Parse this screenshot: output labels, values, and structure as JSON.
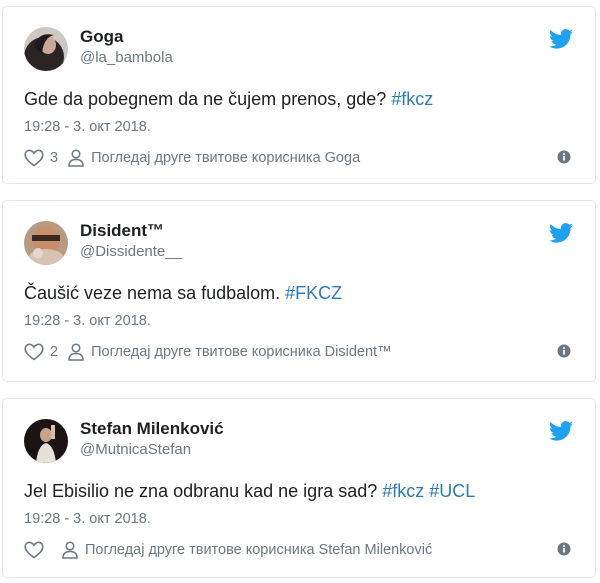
{
  "colors": {
    "hashtag": "#2b7bb9",
    "twitter_blue": "#1da1f2",
    "muted": "#697882",
    "text": "#1c2022",
    "border": "#e1e8ed"
  },
  "tweets": [
    {
      "name": "Goga",
      "handle": "@la_bambola",
      "text": "Gde da pobegnem da ne čujem prenos, gde? ",
      "hashtags": [
        "#fkcz"
      ],
      "date": "19:28 - 3. окт 2018.",
      "likes": "3",
      "profile_link": "Погледај друге твитове корисника Goga",
      "icons": [
        "avatar",
        "twitter-bird-icon",
        "heart-icon",
        "person-icon",
        "info-icon"
      ]
    },
    {
      "name": "Disident™",
      "handle": "@Dissidente__",
      "text": "Čaušić veze nema sa fudbalom. ",
      "hashtags": [
        "#FKCZ"
      ],
      "date": "19:28 - 3. окт 2018.",
      "likes": "2",
      "profile_link": "Погледај друге твитове корисника Disident™",
      "icons": [
        "avatar",
        "twitter-bird-icon",
        "heart-icon",
        "person-icon",
        "info-icon"
      ]
    },
    {
      "name": "Stefan Milenković",
      "handle": "@MutnicaStefan",
      "text": "Jel Ebisilio ne zna odbranu kad ne igra sad? ",
      "hashtags": [
        "#fkcz",
        "#UCL"
      ],
      "date": "19:28 - 3. окт 2018.",
      "likes": "",
      "profile_link": "Погледај друге твитове корисника Stefan Milenković",
      "icons": [
        "avatar",
        "twitter-bird-icon",
        "heart-icon",
        "person-icon",
        "info-icon"
      ]
    }
  ]
}
